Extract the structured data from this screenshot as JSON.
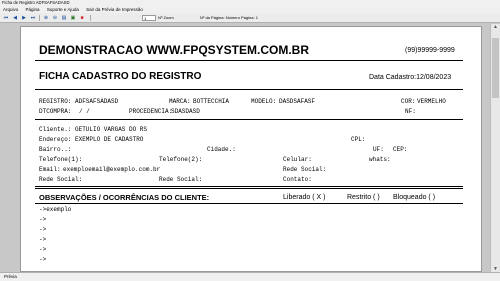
{
  "window": {
    "title": "Ficha de Registro ADFSAFSADASD"
  },
  "menu": [
    "Arquivo",
    "Página",
    "Suporte e Ajuda",
    "Sair da Prévia de Impressão"
  ],
  "toolbar": {
    "page_value": "1",
    "zoom_label": "Nº Zoom",
    "page_info_label": "Nº da Página: Número Página: 1",
    "icons": [
      "first-page-icon",
      "prev-page-icon",
      "next-page-icon",
      "last-page-icon",
      "zoom-in-icon",
      "zoom-out-icon",
      "print-icon",
      "setup-icon",
      "pdf-icon"
    ]
  },
  "document": {
    "company": "DEMONSTRACAO WWW.FPQSYSTEM.COM.BR",
    "phone": "(99)99999-9999",
    "title": "FICHA CADASTRO DO REGISTRO",
    "date": "Data Cadastro:12/08/2023",
    "registro_label": "REGISTRO:",
    "registro_value": "ADFSAFSADASD",
    "marca_label": "MARCA:",
    "marca_value": "BOTTECCHIA",
    "modelo_label": "MODELO:",
    "modelo_value": "DASDSAFASF",
    "cor_label": "COR:",
    "cor_value": "VERMELHO",
    "dtcompra_label": "DTCOMPRA:",
    "dtcompra_value": "/    /",
    "procedencia_label": "PROCEDENCIA:",
    "procedencia_value": "SDASDASD",
    "nf_label": "NF:",
    "cliente_label": "Cliente.:",
    "cliente_value": "GETULIO VARGAS DO RS",
    "endereco_label": "Endereço:",
    "endereco_value": "EXEMPLO DE CADASTRO",
    "cpl_label": "CPL:",
    "bairro_label": "Bairro..:",
    "cidade_label": "Cidade.:",
    "uf_label": "UF:",
    "cep_label": "CEP:",
    "telefone1_label": "Telefone(1):",
    "telefone2_label": "Telefone(2):",
    "celular_label": "Celular:",
    "whats_label": "whats:",
    "email_label": "Email:",
    "email_value": "exemploemail@exemplo.com.br",
    "rede1_label": "Rede Social:",
    "rede2_label": "Rede Social:",
    "rede3_label": "Rede Social:",
    "contato_label": "Contato:",
    "obs_label": "OBSERVAÇÕES / OCORRÊNCIAS DO CLIENTE:",
    "liberado": "Liberado (  X  )",
    "restrito": "Restrito (    )",
    "bloqueado": "Bloqueado (    )",
    "obs_lines": [
      "->exemplo",
      "->",
      "->",
      "->",
      "->",
      "->"
    ]
  },
  "status": {
    "text": "Prévia"
  }
}
